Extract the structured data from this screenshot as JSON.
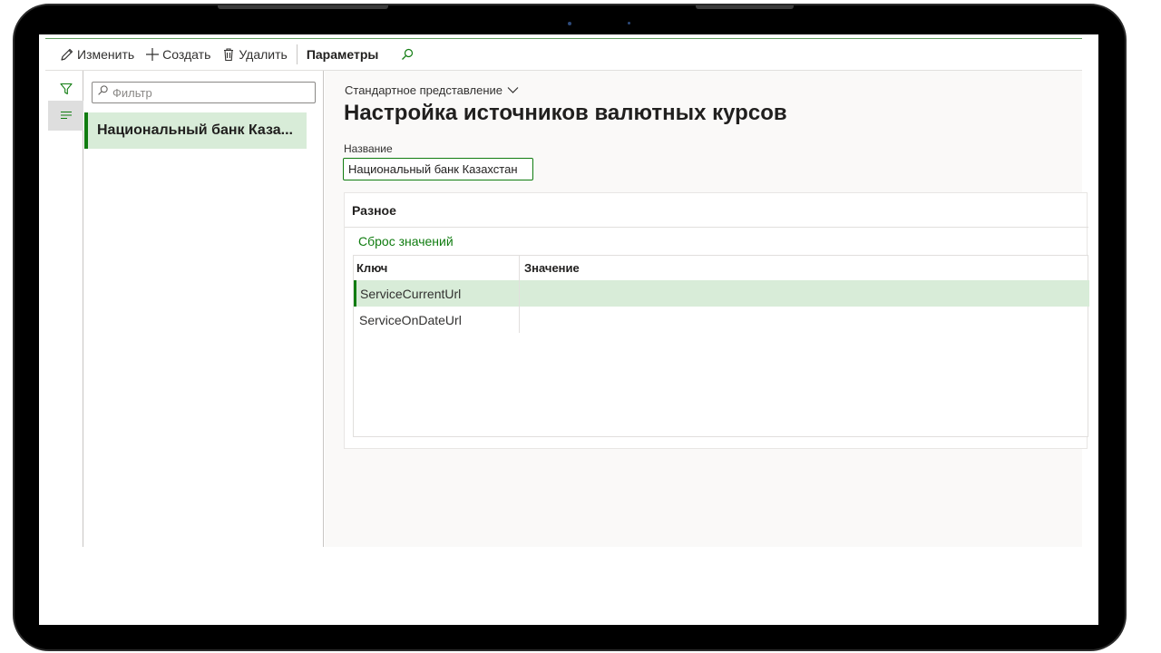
{
  "action_pane": {
    "edit_label": "Изменить",
    "new_label": "Создать",
    "delete_label": "Удалить",
    "options_label": "Параметры"
  },
  "list": {
    "filter_placeholder": "Фильтр",
    "items": [
      {
        "label": "Национальный банк Каза..."
      }
    ]
  },
  "details": {
    "view_name": "Стандартное представление",
    "page_title": "Настройка источников валютных курсов",
    "name_label": "Название",
    "name_value": "Национальный банк Казахстан",
    "fasttab_title": "Разное",
    "reset_link": "Сброс значений",
    "grid": {
      "columns": [
        "Ключ",
        "Значение"
      ],
      "rows": [
        {
          "key": "ServiceCurrentUrl",
          "value": ""
        },
        {
          "key": "ServiceOnDateUrl",
          "value": ""
        }
      ]
    }
  },
  "colors": {
    "accent": "#107c10",
    "selection": "#d8ecd8",
    "frame": "#000000"
  },
  "icons": [
    "pencil-icon",
    "plus-icon",
    "trash-icon",
    "search-icon",
    "funnel-icon",
    "list-icon",
    "chevron-down-icon"
  ]
}
